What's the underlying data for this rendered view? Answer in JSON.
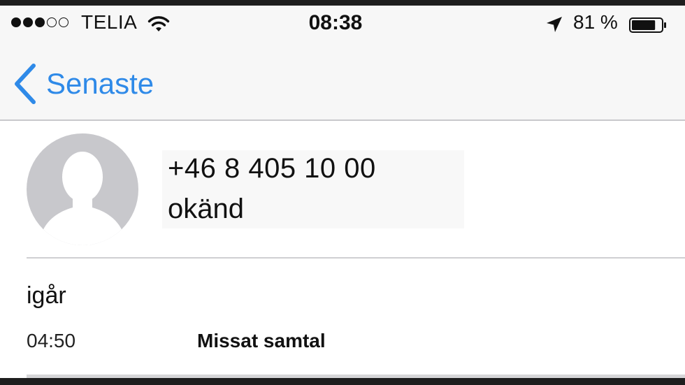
{
  "status_bar": {
    "signal_bars": 5,
    "signal_filled": 3,
    "carrier": "TELIA",
    "time": "08:38",
    "battery_percent": "81 %",
    "battery_level": 0.81,
    "icons": [
      "signal-dots-icon",
      "wifi-icon",
      "location-arrow-icon",
      "battery-icon"
    ]
  },
  "nav": {
    "back_label": "Senaste",
    "back_icon": "chevron-left-icon"
  },
  "contact": {
    "number": "+46 8 405 10 00",
    "label": "okänd",
    "avatar_icon": "person-silhouette-icon"
  },
  "history": {
    "date": "igår",
    "calls": [
      {
        "time": "04:50",
        "type": "Missat samtal"
      }
    ]
  },
  "colors": {
    "accent": "#2f8ae8",
    "bar_background": "#f7f7f7",
    "avatar_background": "#c8c8cc"
  }
}
